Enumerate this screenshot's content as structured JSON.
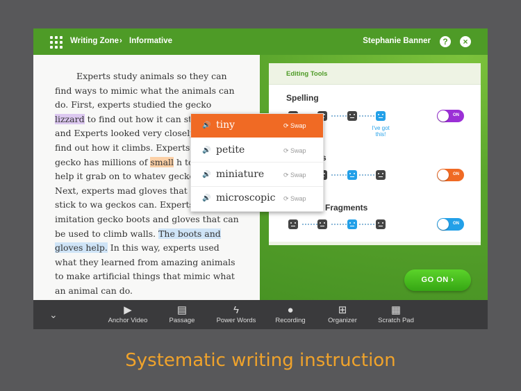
{
  "header": {
    "breadcrumb": [
      "Writing Zone",
      "Informative"
    ],
    "user_name": "Stephanie Banner",
    "icons": [
      "grid-icon",
      "help-icon",
      "close-icon"
    ]
  },
  "essay": {
    "before_lizzard": "Experts study animals so they can find ways to mimic what the animals can do. First, experts studied the gecko ",
    "hl_lizzard": "lizzard",
    "lizzard_to_small": " to find out how it can stick to walls and Experts looked very closely at the ",
    "gecko_foot": "find out how it climbs. Experts lea",
    "before_small": "the gecko has millions of ",
    "hl_small": "small",
    "after_small": " h toes that help it grab on to whatev gecko steps on. Next, experts mad gloves that help people stick to wa geckos can. Experts made imitation gecko boots and gloves that can be used to climb walls. ",
    "hl_boots": "The boots and gloves help.",
    "ending": " In this way, experts used what they learned from amazing animals to make artificial things that mimic what an animal can do."
  },
  "editing_tools": {
    "title": "Editing Tools",
    "rows": [
      {
        "label": "Spelling",
        "toggle": "ON",
        "toggle_color": "#9b2fd6"
      },
      {
        "label": "rds",
        "toggle": "ON",
        "toggle_color": "#f06a24"
      },
      {
        "label": "Fragments",
        "toggle": "ON",
        "toggle_color": "#23a0e8"
      }
    ],
    "feedback_text": "I've got this!"
  },
  "word_popup": {
    "options": [
      {
        "word": "tiny",
        "swap": "Swap",
        "selected": true
      },
      {
        "word": "petite",
        "swap": "Swap",
        "selected": false
      },
      {
        "word": "miniature",
        "swap": "Swap",
        "selected": false
      },
      {
        "word": "microscopic",
        "swap": "Swap",
        "selected": false
      }
    ],
    "accent_color": "#f06a24"
  },
  "go_button": {
    "label": "GO ON ›"
  },
  "toolbar": {
    "items": [
      {
        "label": "Anchor Video",
        "icon": "video-icon"
      },
      {
        "label": "Passage",
        "icon": "passage-icon"
      },
      {
        "label": "Power Words",
        "icon": "power-words-icon"
      },
      {
        "label": "Recording",
        "icon": "microphone-icon"
      },
      {
        "label": "Organizer",
        "icon": "organizer-icon"
      },
      {
        "label": "Scratch Pad",
        "icon": "scratch-pad-icon"
      }
    ]
  },
  "tagline": "Systematic writing instruction",
  "colors": {
    "brand_green": "#4e9b27",
    "tagline": "#f0a32b",
    "toolbar_bg": "#3a3a3c"
  }
}
